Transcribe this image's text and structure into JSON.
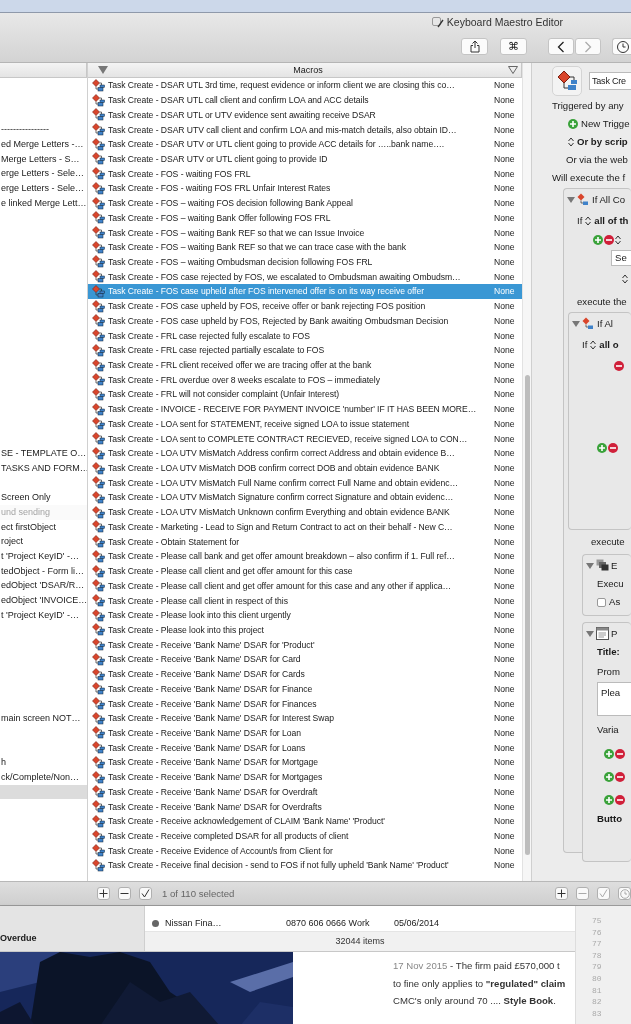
{
  "window": {
    "title": "Keyboard Maestro Editor"
  },
  "toolbar": {
    "command_key": "⌘"
  },
  "macros_header": {
    "label": "Macros"
  },
  "groups": [
    {
      "label": "----------------",
      "selected": false,
      "disabled": false
    },
    {
      "label": "ed Merge Letters -…",
      "selected": false,
      "disabled": false
    },
    {
      "label": "Merge Letters - S…",
      "selected": false,
      "disabled": false
    },
    {
      "label": "erge Letters - Sele…",
      "selected": false,
      "disabled": false
    },
    {
      "label": "erge Letters - Sele…",
      "selected": false,
      "disabled": false
    },
    {
      "label": "e linked Merge Lett…",
      "selected": false,
      "disabled": false
    },
    {
      "label": "SE - TEMPLATE O…",
      "selected": false,
      "disabled": false
    },
    {
      "label": "TASKS AND FORM…",
      "selected": false,
      "disabled": false
    },
    {
      "label": "Screen Only",
      "selected": false,
      "disabled": false
    },
    {
      "label": "und sending",
      "selected": false,
      "disabled": true
    },
    {
      "label": "ect firstObject",
      "selected": false,
      "disabled": false
    },
    {
      "label": "roject",
      "selected": false,
      "disabled": false
    },
    {
      "label": "t 'Project KeyID' -…",
      "selected": false,
      "disabled": false
    },
    {
      "label": "tedObject - Form li…",
      "selected": false,
      "disabled": false
    },
    {
      "label": "edObject 'DSAR/R…",
      "selected": false,
      "disabled": false
    },
    {
      "label": "edObject 'INVOICE…",
      "selected": false,
      "disabled": false
    },
    {
      "label": "t 'Project KeyID' -…",
      "selected": false,
      "disabled": false
    },
    {
      "label": "main screen NOT…",
      "selected": false,
      "disabled": false
    },
    {
      "label": "h",
      "selected": false,
      "disabled": false
    },
    {
      "label": "ck/Complete/Non…",
      "selected": false,
      "disabled": false
    },
    {
      "selected": true,
      "disabled": false
    }
  ],
  "macros": [
    {
      "name": "Task Create - DSAR UTL 3rd time, request evidence or inform client we are closing this co…",
      "trigger": "None",
      "selected": false
    },
    {
      "name": "Task Create - DSAR UTL call client and confirm LOA and ACC details",
      "trigger": "None",
      "selected": false
    },
    {
      "name": "Task Create - DSAR UTL or UTV evidence sent awaiting receive DSAR",
      "trigger": "None",
      "selected": false
    },
    {
      "name": "Task Create - DSAR UTV call client and confirm LOA and mis-match details, also obtain ID…",
      "trigger": "None",
      "selected": false
    },
    {
      "name": "Task Create - DSAR UTV or UTL client going to provide ACC details for …..bank name….",
      "trigger": "None",
      "selected": false
    },
    {
      "name": "Task Create - DSAR UTV or UTL client going to provide ID",
      "trigger": "None",
      "selected": false
    },
    {
      "name": "Task Create - FOS - waiting FOS FRL",
      "trigger": "None",
      "selected": false
    },
    {
      "name": "Task Create - FOS - waiting FOS FRL Unfair Interest Rates",
      "trigger": "None",
      "selected": false
    },
    {
      "name": "Task Create - FOS – waiting  FOS decision following Bank Appeal",
      "trigger": "None",
      "selected": false
    },
    {
      "name": "Task Create - FOS – waiting Bank Offer following FOS FRL",
      "trigger": "None",
      "selected": false
    },
    {
      "name": "Task Create - FOS – waiting Bank REF so that we can Issue Invoice",
      "trigger": "None",
      "selected": false
    },
    {
      "name": "Task Create - FOS – waiting Bank REF so that we can trace case with the bank",
      "trigger": "None",
      "selected": false
    },
    {
      "name": "Task Create - FOS – waiting Ombudsman decision following FOS FRL",
      "trigger": "None",
      "selected": false
    },
    {
      "name": "Task Create - FOS case rejected by FOS, we escalated to Ombudsman awaiting Ombudsm…",
      "trigger": "None",
      "selected": false
    },
    {
      "name": "Task Create - FOS case upheld after FOS intervened offer is on its way receive offer",
      "trigger": "None",
      "selected": true
    },
    {
      "name": "Task Create - FOS case upheld by FOS, receive offer or bank rejecting FOS position",
      "trigger": "None",
      "selected": false
    },
    {
      "name": "Task Create - FOS case upheld by FOS, Rejected by Bank awaiting Ombudsman Decision",
      "trigger": "None",
      "selected": false
    },
    {
      "name": "Task Create - FRL case rejected fully escalate to FOS",
      "trigger": "None",
      "selected": false
    },
    {
      "name": "Task Create - FRL case rejected partially escalate to FOS",
      "trigger": "None",
      "selected": false
    },
    {
      "name": "Task Create - FRL client received offer we are tracing offer at the bank",
      "trigger": "None",
      "selected": false
    },
    {
      "name": "Task Create - FRL overdue over 8 weeks escalate to FOS – immediately",
      "trigger": "None",
      "selected": false
    },
    {
      "name": "Task Create - FRL will not consider complaint (Unfair Interest)",
      "trigger": "None",
      "selected": false
    },
    {
      "name": "Task Create - INVOICE - RECEIVE FOR PAYMENT INVOICE 'number' IF IT HAS BEEN MORE…",
      "trigger": "None",
      "selected": false
    },
    {
      "name": "Task Create - LOA sent for STATEMENT, receive signed LOA to issue statement",
      "trigger": "None",
      "selected": false
    },
    {
      "name": "Task Create - LOA sent to COMPLETE CONTRACT RECIEVED, receive signed LOA to CON…",
      "trigger": "None",
      "selected": false
    },
    {
      "name": "Task Create - LOA UTV MisMatch Address confirm correct Address and obtain evidence B…",
      "trigger": "None",
      "selected": false
    },
    {
      "name": "Task Create - LOA UTV MisMatch DOB confirm correct DOB and obtain evidence BANK",
      "trigger": "None",
      "selected": false
    },
    {
      "name": "Task Create - LOA UTV MisMatch Full Name confirm correct Full Name and obtain evidenc…",
      "trigger": "None",
      "selected": false
    },
    {
      "name": "Task Create - LOA UTV MisMatch Signature confirm correct Signature and obtain evidenc…",
      "trigger": "None",
      "selected": false
    },
    {
      "name": "Task Create - LOA UTV MisMatch Unknown confirm Everything and obtain evidence BANK",
      "trigger": "None",
      "selected": false
    },
    {
      "name": "Task Create - Marketing - Lead to Sign and Return Contract to act on their behalf - New C…",
      "trigger": "None",
      "selected": false
    },
    {
      "name": "Task Create - Obtain Statement for",
      "trigger": "None",
      "selected": false
    },
    {
      "name": "Task Create - Please call bank and get offer amount breakdown – also confirm if 1. Full ref…",
      "trigger": "None",
      "selected": false
    },
    {
      "name": "Task Create - Please call client and get offer amount for this case",
      "trigger": "None",
      "selected": false
    },
    {
      "name": "Task Create - Please call client and get offer amount for this case and any other if applica…",
      "trigger": "None",
      "selected": false
    },
    {
      "name": "Task Create - Please call client in respect of this",
      "trigger": "None",
      "selected": false
    },
    {
      "name": "Task Create - Please look into this client urgently",
      "trigger": "None",
      "selected": false
    },
    {
      "name": "Task Create - Please look into this project",
      "trigger": "None",
      "selected": false
    },
    {
      "name": "Task Create - Receive 'Bank Name' DSAR for 'Product'",
      "trigger": "None",
      "selected": false
    },
    {
      "name": "Task Create - Receive 'Bank Name' DSAR for Card",
      "trigger": "None",
      "selected": false
    },
    {
      "name": "Task Create - Receive 'Bank Name' DSAR for Cards",
      "trigger": "None",
      "selected": false
    },
    {
      "name": "Task Create - Receive 'Bank Name' DSAR for Finance",
      "trigger": "None",
      "selected": false
    },
    {
      "name": "Task Create - Receive 'Bank Name' DSAR for Finances",
      "trigger": "None",
      "selected": false
    },
    {
      "name": "Task Create - Receive 'Bank Name' DSAR for Interest Swap",
      "trigger": "None",
      "selected": false
    },
    {
      "name": "Task Create - Receive 'Bank Name' DSAR for Loan",
      "trigger": "None",
      "selected": false
    },
    {
      "name": "Task Create - Receive 'Bank Name' DSAR for Loans",
      "trigger": "None",
      "selected": false
    },
    {
      "name": "Task Create - Receive 'Bank Name' DSAR for Mortgage",
      "trigger": "None",
      "selected": false
    },
    {
      "name": "Task Create - Receive 'Bank Name' DSAR for Mortgages",
      "trigger": "None",
      "selected": false
    },
    {
      "name": "Task Create - Receive 'Bank Name' DSAR for Overdraft",
      "trigger": "None",
      "selected": false
    },
    {
      "name": "Task Create - Receive 'Bank Name' DSAR for Overdrafts",
      "trigger": "None",
      "selected": false
    },
    {
      "name": "Task Create - Receive acknowledgement of CLAIM 'Bank Name' 'Product'",
      "trigger": "None",
      "selected": false
    },
    {
      "name": "Task Create - Receive completed DSAR for all products of client",
      "trigger": "None",
      "selected": false
    },
    {
      "name": "Task Create - Receive Evidence of Account/s from Client for",
      "trigger": "None",
      "selected": false
    },
    {
      "name": "Task Create - Receive final decision - send to FOS if not fully upheld 'Bank Name' 'Product'",
      "trigger": "None",
      "selected": false
    }
  ],
  "editor": {
    "name_field": "Task Cre",
    "triggered_by": "Triggered by any",
    "new_trigger": "New Trigge",
    "script_option": "Or by scrip",
    "web_option": "Or via the web",
    "execute_label": "Will execute the f",
    "if_action": {
      "title": "If All Co",
      "expanded": true,
      "if_label": "If",
      "condition": "all of th",
      "select_value": "Se",
      "execute_label": "execute the",
      "inner_if": {
        "title": "If Al",
        "expanded": true,
        "if_label": "If",
        "condition": "all o"
      }
    },
    "execute_label_2": "execute",
    "execute_action": {
      "title": "E",
      "expanded": true,
      "label": "Execu",
      "checkbox_label": "As",
      "checked": false
    },
    "prompt_action": {
      "title": "P",
      "expanded": true,
      "title_label": "Title:",
      "prompt_label": "Prom",
      "prompt_value": "Plea",
      "variables_label": "Varia",
      "buttons_label": "Butto"
    }
  },
  "footer": {
    "count": "1 of 110 selected"
  },
  "background": {
    "sidebar_item": "Overdue",
    "table_row": {
      "name": "Nissan Fina…",
      "phone": "0870 606 0666 Work",
      "date": "05/06/2014"
    },
    "item_count": "32044 items",
    "snippet": {
      "date": "17 Nov 2015",
      "lines": [
        "- The firm paid £570,000 t",
        "to fine only applies to **\"regulated\" claim**",
        "CMC's only around 70 .... **Style Book**."
      ]
    },
    "line_numbers": [
      "75",
      "76",
      "77",
      "78",
      "79",
      "80",
      "81",
      "82",
      "83"
    ]
  }
}
